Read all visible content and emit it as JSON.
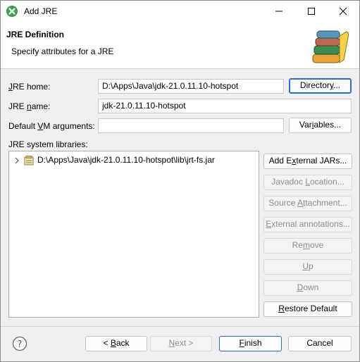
{
  "window": {
    "title": "Add JRE"
  },
  "header": {
    "title": "JRE Definition",
    "subtitle": "Specify attributes for a JRE"
  },
  "form": {
    "jre_home_label": "JRE home:",
    "jre_home_value": "D:\\Apps\\Java\\jdk-21.0.11.10-hotspot",
    "directory_button": "Directory...",
    "jre_name_label": "JRE name:",
    "jre_name_value": "jdk-21.0.11.10-hotspot",
    "vm_args_label": "Default VM arguments:",
    "vm_args_value": "",
    "variables_button": "Variables...",
    "libraries_label": "JRE system libraries:"
  },
  "libraries": [
    {
      "path": "D:\\Apps\\Java\\jdk-21.0.11.10-hotspot\\lib\\jrt-fs.jar",
      "icon": "jar-icon",
      "expanded": false
    }
  ],
  "side_buttons": {
    "add_external_jars": "Add External JARs...",
    "javadoc_location": "Javadoc Location...",
    "source_attachment": "Source Attachment...",
    "external_annotations": "External annotations...",
    "remove": "Remove",
    "up": "Up",
    "down": "Down",
    "restore_default": "Restore Default"
  },
  "footer": {
    "back": "< Back",
    "next": "Next >",
    "finish": "Finish",
    "cancel": "Cancel"
  },
  "colors": {
    "accent": "#2b6bc9",
    "disabled_text": "#8c8c8c",
    "app_icon": "#3aa64a"
  }
}
